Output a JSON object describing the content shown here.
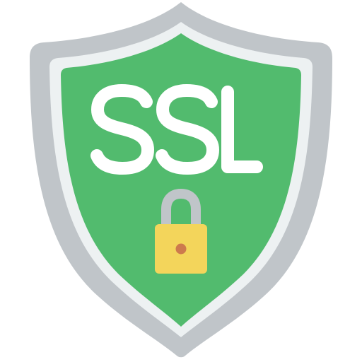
{
  "badge": {
    "text": "SSL",
    "icon": "ssl-shield-icon",
    "lock_icon": "padlock-icon"
  },
  "colors": {
    "shield_outer": "#c0c5c9",
    "shield_inner_rim": "#edf1f2",
    "shield_face": "#52bb6e",
    "lettering": "#ffffff",
    "shackle": "#c0c5c9",
    "lock_body": "#f3d55b",
    "keyhole": "#cd7a4d"
  }
}
